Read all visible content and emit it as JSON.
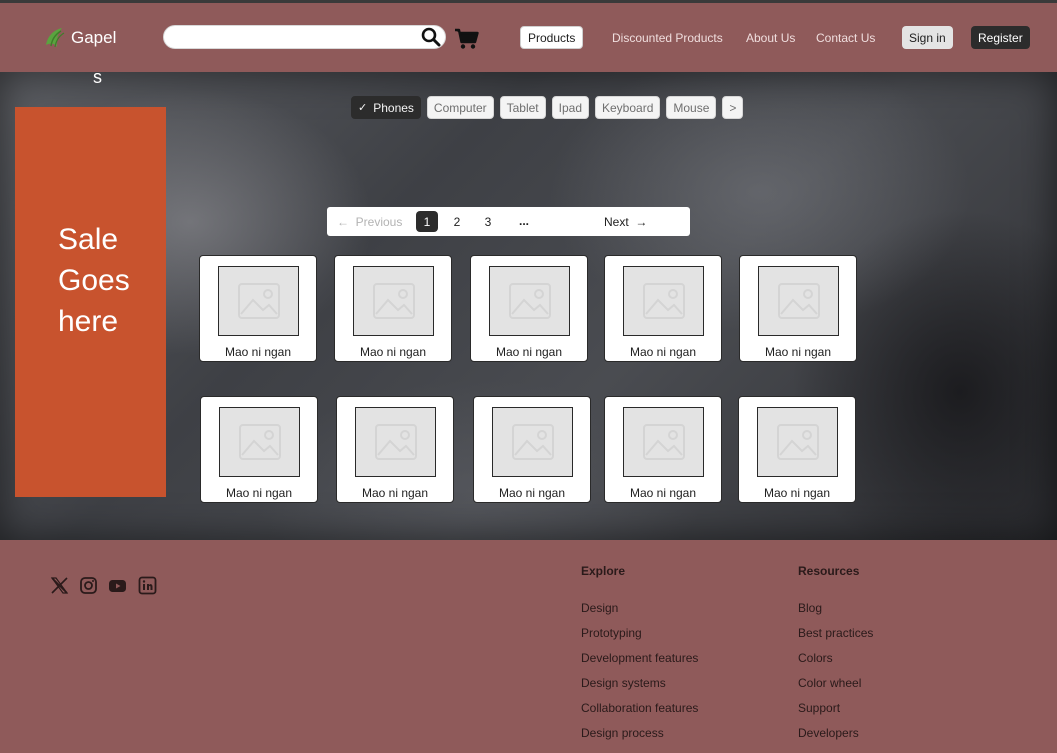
{
  "header": {
    "logo_text": "Gapel",
    "search": {
      "value": "",
      "placeholder": ""
    },
    "nav": {
      "products": "Products",
      "discounted": "Discounted Products",
      "about": "About Us",
      "contact": "Contact Us",
      "sign_in": "Sign in",
      "register": "Register"
    }
  },
  "hero": {
    "stray_text": "s",
    "sale_lines": [
      "Sale",
      "Goes",
      "here"
    ],
    "categories": [
      {
        "label": "Phones",
        "active": true
      },
      {
        "label": "Computer",
        "active": false
      },
      {
        "label": "Tablet",
        "active": false
      },
      {
        "label": "Ipad",
        "active": false
      },
      {
        "label": "Keyboard",
        "active": false
      },
      {
        "label": "Mouse",
        "active": false
      },
      {
        "label": ">",
        "active": false
      }
    ],
    "pagination": {
      "previous": "Previous",
      "pages": [
        "1",
        "2",
        "3"
      ],
      "current": "1",
      "ellipsis": "...",
      "next": "Next"
    },
    "products": [
      {
        "name": "Mao ni ngan"
      },
      {
        "name": "Mao ni ngan"
      },
      {
        "name": "Mao ni ngan"
      },
      {
        "name": "Mao ni ngan"
      },
      {
        "name": "Mao ni ngan"
      },
      {
        "name": "Mao ni ngan"
      },
      {
        "name": "Mao ni ngan"
      },
      {
        "name": "Mao ni ngan"
      },
      {
        "name": "Mao ni ngan"
      },
      {
        "name": "Mao ni ngan"
      }
    ]
  },
  "footer": {
    "social_icons": [
      "x-icon",
      "instagram-icon",
      "youtube-icon",
      "linkedin-icon"
    ],
    "explore": {
      "title": "Explore",
      "links": [
        "Design",
        "Prototyping",
        "Development features",
        "Design systems",
        "Collaboration features",
        "Design process"
      ]
    },
    "resources": {
      "title": "Resources",
      "links": [
        "Blog",
        "Best practices",
        "Colors",
        "Color wheel",
        "Support",
        "Developers"
      ]
    }
  },
  "colors": {
    "brand_background": "#8f5a5a",
    "sale_banner": "#c8532e",
    "logo_green": "#5aa33f",
    "dark_button": "#2c2c2c"
  }
}
